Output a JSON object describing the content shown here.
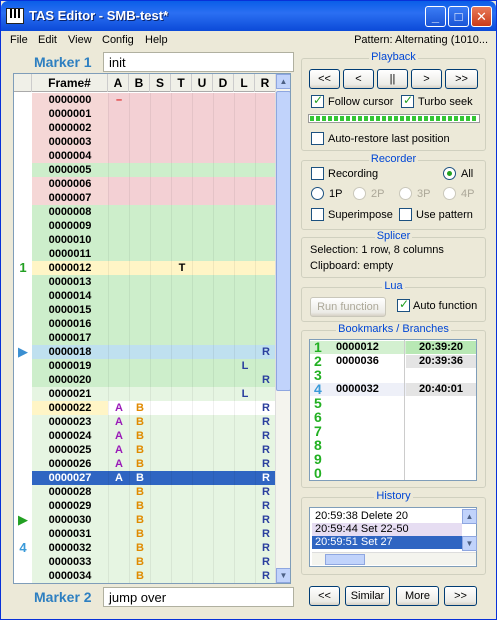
{
  "window": {
    "title": "TAS Editor - SMB-test*",
    "minimize": "_",
    "maximize": "□",
    "close": "✕"
  },
  "menu": [
    "File",
    "Edit",
    "View",
    "Config",
    "Help"
  ],
  "pattern_status": "Pattern: Alternating (1010...",
  "marker_top": {
    "label": "Marker 1",
    "note": "init"
  },
  "marker_bottom": {
    "label": "Marker 2",
    "note": "jump over"
  },
  "grid": {
    "columns": [
      "Frame#",
      "A",
      "B",
      "S",
      "T",
      "U",
      "D",
      "L",
      "R"
    ],
    "scroll_up": "▲",
    "scroll_down": "▼",
    "rows": [
      {
        "frame": "0000000",
        "ind": "",
        "A": "–",
        "B": "",
        "S": "",
        "T": "",
        "U": "",
        "D": "",
        "L": "",
        "R": "",
        "zone": "lag"
      },
      {
        "frame": "0000001",
        "ind": "",
        "A": "",
        "B": "",
        "S": "",
        "T": "",
        "U": "",
        "D": "",
        "L": "",
        "R": "",
        "zone": "lag"
      },
      {
        "frame": "0000002",
        "ind": "",
        "A": "",
        "B": "",
        "S": "",
        "T": "",
        "U": "",
        "D": "",
        "L": "",
        "R": "",
        "zone": "lag"
      },
      {
        "frame": "0000003",
        "ind": "",
        "A": "",
        "B": "",
        "S": "",
        "T": "",
        "U": "",
        "D": "",
        "L": "",
        "R": "",
        "zone": "lag"
      },
      {
        "frame": "0000004",
        "ind": "",
        "A": "",
        "B": "",
        "S": "",
        "T": "",
        "U": "",
        "D": "",
        "L": "",
        "R": "",
        "zone": "lag"
      },
      {
        "frame": "0000005",
        "ind": "",
        "A": "",
        "B": "",
        "S": "",
        "T": "",
        "U": "",
        "D": "",
        "L": "",
        "R": "",
        "zone": "green"
      },
      {
        "frame": "0000006",
        "ind": "",
        "A": "",
        "B": "",
        "S": "",
        "T": "",
        "U": "",
        "D": "",
        "L": "",
        "R": "",
        "zone": "lag"
      },
      {
        "frame": "0000007",
        "ind": "",
        "A": "",
        "B": "",
        "S": "",
        "T": "",
        "U": "",
        "D": "",
        "L": "",
        "R": "",
        "zone": "lag"
      },
      {
        "frame": "0000008",
        "ind": "",
        "A": "",
        "B": "",
        "S": "",
        "T": "",
        "U": "",
        "D": "",
        "L": "",
        "R": "",
        "zone": "green"
      },
      {
        "frame": "0000009",
        "ind": "",
        "A": "",
        "B": "",
        "S": "",
        "T": "",
        "U": "",
        "D": "",
        "L": "",
        "R": "",
        "zone": "green"
      },
      {
        "frame": "0000010",
        "ind": "",
        "A": "",
        "B": "",
        "S": "",
        "T": "",
        "U": "",
        "D": "",
        "L": "",
        "R": "",
        "zone": "green"
      },
      {
        "frame": "0000011",
        "ind": "",
        "A": "",
        "B": "",
        "S": "",
        "T": "",
        "U": "",
        "D": "",
        "L": "",
        "R": "",
        "zone": "green"
      },
      {
        "frame": "0000012",
        "ind": "1",
        "A": "",
        "B": "",
        "S": "",
        "T": "T",
        "U": "",
        "D": "",
        "L": "",
        "R": "",
        "zone": "marker"
      },
      {
        "frame": "0000013",
        "ind": "",
        "A": "",
        "B": "",
        "S": "",
        "T": "",
        "U": "",
        "D": "",
        "L": "",
        "R": "",
        "zone": "green"
      },
      {
        "frame": "0000014",
        "ind": "",
        "A": "",
        "B": "",
        "S": "",
        "T": "",
        "U": "",
        "D": "",
        "L": "",
        "R": "",
        "zone": "green"
      },
      {
        "frame": "0000015",
        "ind": "",
        "A": "",
        "B": "",
        "S": "",
        "T": "",
        "U": "",
        "D": "",
        "L": "",
        "R": "",
        "zone": "green"
      },
      {
        "frame": "0000016",
        "ind": "",
        "A": "",
        "B": "",
        "S": "",
        "T": "",
        "U": "",
        "D": "",
        "L": "",
        "R": "",
        "zone": "green"
      },
      {
        "frame": "0000017",
        "ind": "",
        "A": "",
        "B": "",
        "S": "",
        "T": "",
        "U": "",
        "D": "",
        "L": "",
        "R": "",
        "zone": "green"
      },
      {
        "frame": "0000018",
        "ind": "▶",
        "A": "",
        "B": "",
        "S": "",
        "T": "",
        "U": "",
        "D": "",
        "L": "",
        "R": "R",
        "zone": "cursor"
      },
      {
        "frame": "0000019",
        "ind": "",
        "A": "",
        "B": "",
        "S": "",
        "T": "",
        "U": "",
        "D": "",
        "L": "L",
        "R": "",
        "zone": "green"
      },
      {
        "frame": "0000020",
        "ind": "",
        "A": "",
        "B": "",
        "S": "",
        "T": "",
        "U": "",
        "D": "",
        "L": "",
        "R": "R",
        "zone": "green"
      },
      {
        "frame": "0000021",
        "ind": "",
        "A": "",
        "B": "",
        "S": "",
        "T": "",
        "U": "",
        "D": "",
        "L": "L",
        "R": "",
        "zone": "light"
      },
      {
        "frame": "0000022",
        "ind": "",
        "A": "A",
        "B": "B",
        "S": "",
        "T": "",
        "U": "",
        "D": "",
        "L": "",
        "R": "R",
        "zone": "marker2"
      },
      {
        "frame": "0000023",
        "ind": "",
        "A": "A",
        "B": "B",
        "S": "",
        "T": "",
        "U": "",
        "D": "",
        "L": "",
        "R": "R",
        "zone": "light"
      },
      {
        "frame": "0000024",
        "ind": "",
        "A": "A",
        "B": "B",
        "S": "",
        "T": "",
        "U": "",
        "D": "",
        "L": "",
        "R": "R",
        "zone": "light"
      },
      {
        "frame": "0000025",
        "ind": "",
        "A": "A",
        "B": "B",
        "S": "",
        "T": "",
        "U": "",
        "D": "",
        "L": "",
        "R": "R",
        "zone": "light"
      },
      {
        "frame": "0000026",
        "ind": "",
        "A": "A",
        "B": "B",
        "S": "",
        "T": "",
        "U": "",
        "D": "",
        "L": "",
        "R": "R",
        "zone": "light"
      },
      {
        "frame": "0000027",
        "ind": "",
        "A": "A",
        "B": "B",
        "S": "",
        "T": "",
        "U": "",
        "D": "",
        "L": "",
        "R": "R",
        "zone": "selected"
      },
      {
        "frame": "0000028",
        "ind": "",
        "A": "",
        "B": "B",
        "S": "",
        "T": "",
        "U": "",
        "D": "",
        "L": "",
        "R": "R",
        "zone": "light"
      },
      {
        "frame": "0000029",
        "ind": "",
        "A": "",
        "B": "B",
        "S": "",
        "T": "",
        "U": "",
        "D": "",
        "L": "",
        "R": "R",
        "zone": "light"
      },
      {
        "frame": "0000030",
        "ind": "▶",
        "A": "",
        "B": "B",
        "S": "",
        "T": "",
        "U": "",
        "D": "",
        "L": "",
        "R": "R",
        "zone": "light"
      },
      {
        "frame": "0000031",
        "ind": "",
        "A": "",
        "B": "B",
        "S": "",
        "T": "",
        "U": "",
        "D": "",
        "L": "",
        "R": "R",
        "zone": "light"
      },
      {
        "frame": "0000032",
        "ind": "4",
        "A": "",
        "B": "B",
        "S": "",
        "T": "",
        "U": "",
        "D": "",
        "L": "",
        "R": "R",
        "zone": "light"
      },
      {
        "frame": "0000033",
        "ind": "",
        "A": "",
        "B": "B",
        "S": "",
        "T": "",
        "U": "",
        "D": "",
        "L": "",
        "R": "R",
        "zone": "light"
      },
      {
        "frame": "0000034",
        "ind": "",
        "A": "",
        "B": "B",
        "S": "",
        "T": "",
        "U": "",
        "D": "",
        "L": "",
        "R": "R",
        "zone": "light"
      }
    ]
  },
  "playback": {
    "title": "Playback",
    "buttons": [
      "<<",
      "<",
      "||",
      ">",
      ">>"
    ],
    "follow_cursor": "Follow cursor",
    "turbo_seek": "Turbo seek",
    "auto_restore": "Auto-restore last position",
    "progress": 1.0
  },
  "recorder": {
    "title": "Recorder",
    "recording": "Recording",
    "all": "All",
    "p1": "1P",
    "p2": "2P",
    "p3": "3P",
    "p4": "4P",
    "superimpose": "Superimpose",
    "use_pattern": "Use pattern"
  },
  "splicer": {
    "title": "Splicer",
    "selection": "Selection: 1 row, 8 columns",
    "clipboard": "Clipboard: empty"
  },
  "lua": {
    "title": "Lua",
    "run_function": "Run function",
    "auto_function": "Auto function"
  },
  "bookmarks": {
    "title": "Bookmarks / Branches",
    "items": [
      {
        "num": "1",
        "frame": "0000012",
        "time": "20:39:20"
      },
      {
        "num": "2",
        "frame": "0000036",
        "time": "20:39:36"
      },
      {
        "num": "3",
        "frame": "",
        "time": ""
      },
      {
        "num": "4",
        "frame": "0000032",
        "time": "20:40:01"
      },
      {
        "num": "5",
        "frame": "",
        "time": ""
      },
      {
        "num": "6",
        "frame": "",
        "time": ""
      },
      {
        "num": "7",
        "frame": "",
        "time": ""
      },
      {
        "num": "8",
        "frame": "",
        "time": ""
      },
      {
        "num": "9",
        "frame": "",
        "time": ""
      },
      {
        "num": "0",
        "frame": "",
        "time": ""
      }
    ]
  },
  "history": {
    "title": "History",
    "items": [
      "20:59:38 Delete 20",
      "20:59:44 Set 22-50",
      "20:59:51 Set 27"
    ]
  },
  "bottom_buttons": {
    "prev": "<<",
    "similar": "Similar",
    "more": "More",
    "next": ">>"
  },
  "colors": {
    "lag": "#f3d0d4",
    "green": "#cdeecb",
    "light": "#e6f5e2",
    "cursor": "#bfe0ef",
    "selected": "#2f65c2",
    "marker": "#fff5c6",
    "frame_col_lag": "#f5d7d6",
    "accent": "#2d7fc1"
  }
}
